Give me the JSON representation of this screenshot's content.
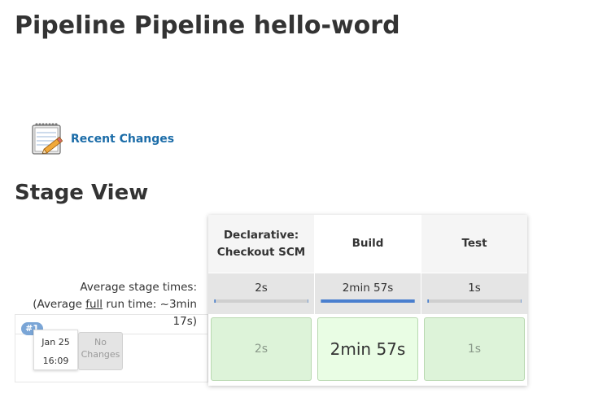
{
  "page": {
    "title": "Pipeline Pipeline hello-word"
  },
  "recent_changes": {
    "label": "Recent Changes",
    "icon": "notepad-icon"
  },
  "stage_view": {
    "title": "Stage View",
    "average_label": "Average stage times:",
    "average_run_prefix": "(Average ",
    "average_run_link": "full",
    "average_run_suffix": " run time: ~3min 17s)",
    "stages": [
      {
        "name_line1": "Declarative:",
        "name_line2": "Checkout SCM",
        "avg_time": "2s",
        "avg_fraction": 0.01,
        "run_time": "2s"
      },
      {
        "name_line1": "Build",
        "name_line2": "",
        "avg_time": "2min 57s",
        "avg_fraction": 1.0,
        "run_time": "2min 57s"
      },
      {
        "name_line1": "Test",
        "name_line2": "",
        "avg_time": "1s",
        "avg_fraction": 0.006,
        "run_time": "1s"
      }
    ],
    "runs": [
      {
        "badge": "#1",
        "date": "Jan 25",
        "time": "16:09",
        "changes_line1": "No",
        "changes_line2": "Changes"
      }
    ]
  },
  "colors": {
    "link": "#1b6ca8",
    "badge": "#7aa5d6",
    "success_cell": "#ddf3d9",
    "progress_fill": "#4a7fcf"
  }
}
